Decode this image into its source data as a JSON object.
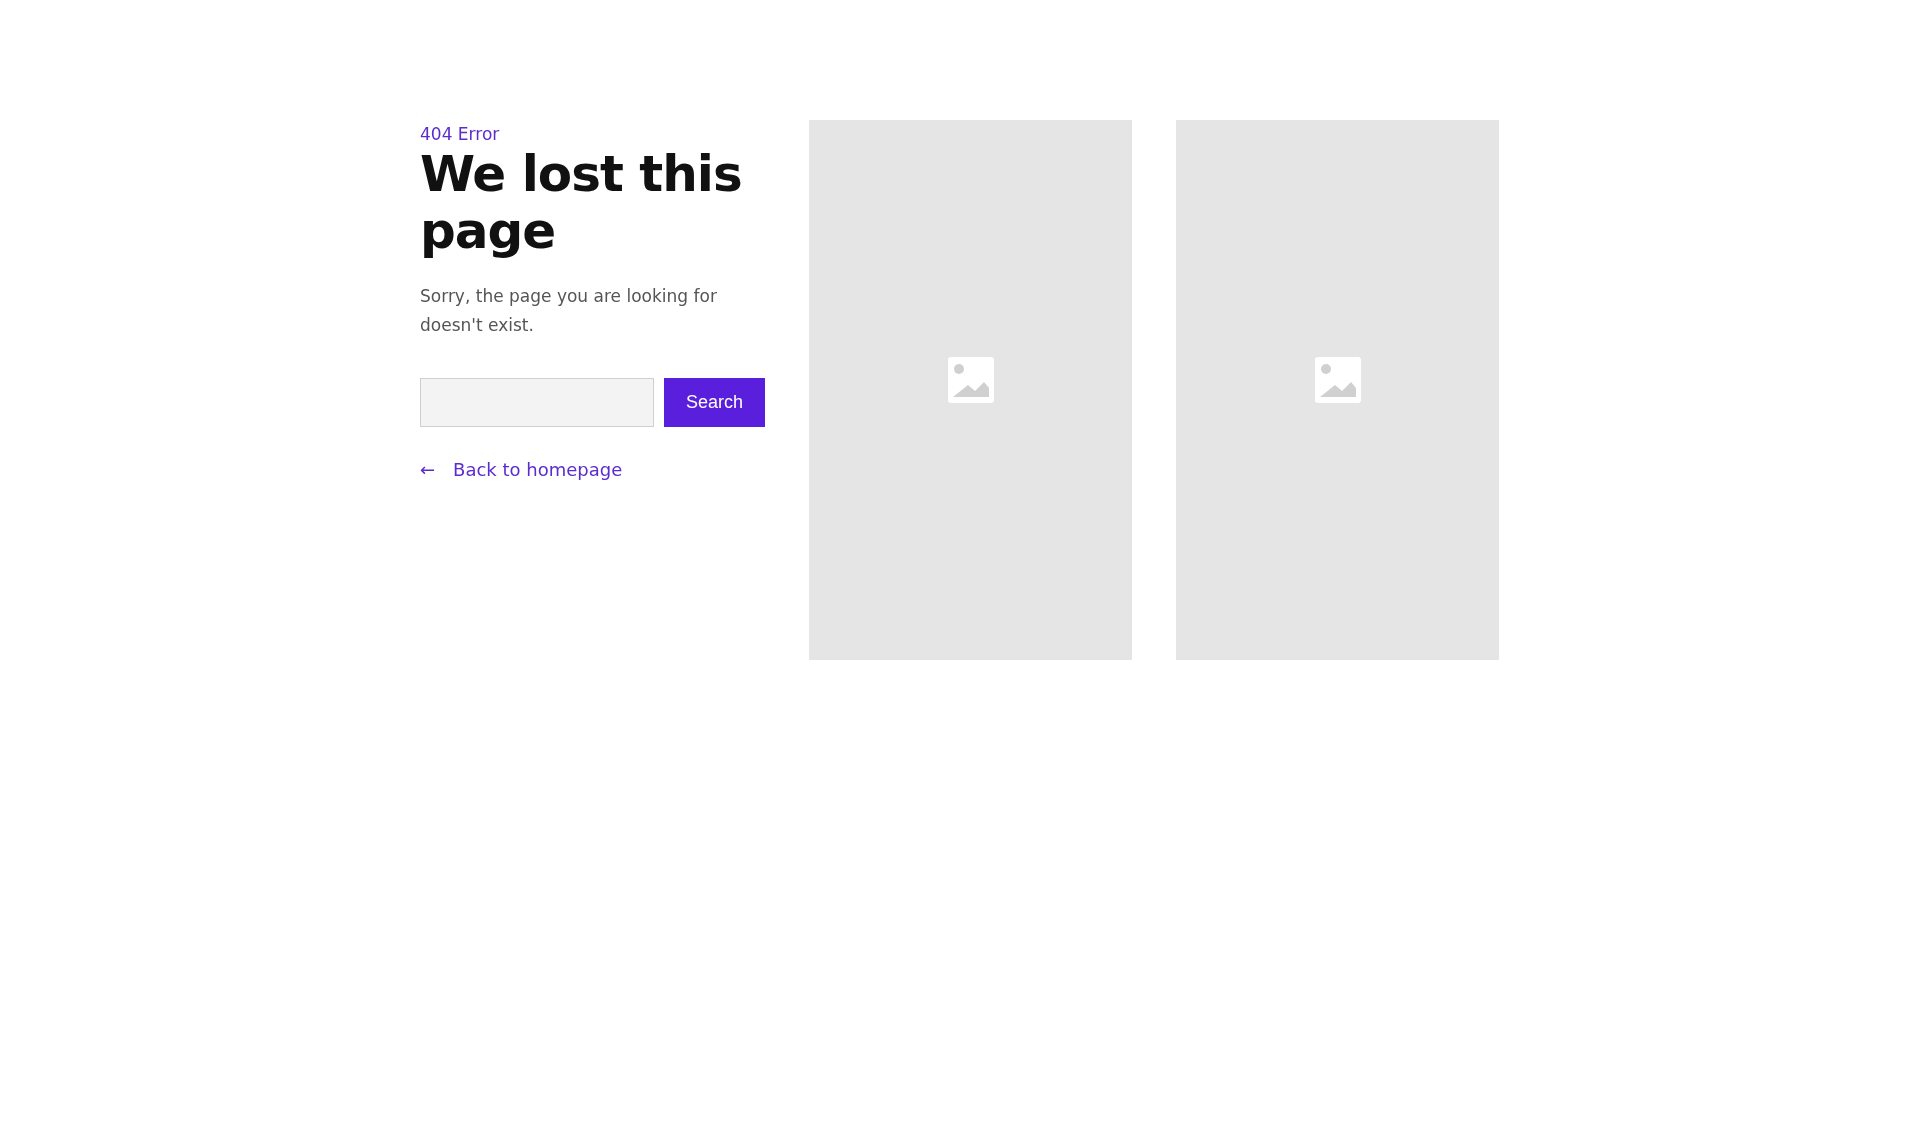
{
  "eyebrow": "404 Error",
  "heading": "We lost this page",
  "message": "Sorry, the page you are looking for doesn't exist.",
  "search": {
    "button": "Search"
  },
  "back_link": {
    "icon": "←",
    "label": "Back to homepage"
  },
  "images": [
    {
      "kind": "placeholder"
    },
    {
      "kind": "placeholder"
    }
  ]
}
